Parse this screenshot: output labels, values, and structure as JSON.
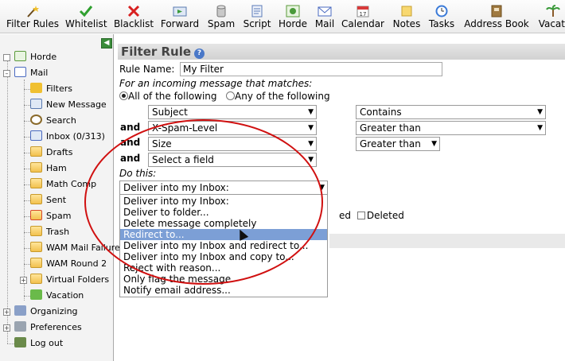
{
  "toolbar": {
    "items": [
      {
        "label": "Filter Rules",
        "icon": "wand-icon",
        "color": "#c89a2a"
      },
      {
        "label": "Whitelist",
        "icon": "checkmark-icon",
        "color": "#3a9a3a"
      },
      {
        "label": "Blacklist",
        "icon": "x-mark-icon",
        "color": "#d42020"
      },
      {
        "label": "Forward",
        "icon": "forward-icon",
        "color": "#3a8a4a"
      },
      {
        "label": "Spam",
        "icon": "spam-can-icon",
        "color": "#8a8a8a"
      },
      {
        "label": "Script",
        "icon": "script-icon",
        "color": "#5a7ab8"
      },
      {
        "label": "Horde",
        "icon": "horde-icon",
        "color": "#4a9a3a"
      },
      {
        "label": "Mail",
        "icon": "mail-icon",
        "color": "#4a6ac0"
      },
      {
        "label": "Calendar",
        "icon": "calendar-icon",
        "color": "#c83a3a"
      },
      {
        "label": "Notes",
        "icon": "notes-icon",
        "color": "#e8b84a"
      },
      {
        "label": "Tasks",
        "icon": "clock-icon",
        "color": "#3a7ad8"
      },
      {
        "label": "Address Book",
        "icon": "address-book-icon",
        "color": "#8a6a3a"
      },
      {
        "label": "Vacati",
        "icon": "palm-tree-icon",
        "color": "#3a9a3a"
      }
    ]
  },
  "sidebar": {
    "top_items": [
      {
        "label": "Horde",
        "icon": "horde-icon"
      },
      {
        "label": "Mail",
        "icon": "mail-icon"
      }
    ],
    "mail_items": [
      {
        "label": "Filters",
        "icon": "wand-icon"
      },
      {
        "label": "New Message",
        "icon": "compose-icon"
      },
      {
        "label": "Search",
        "icon": "search-icon"
      },
      {
        "label": "Inbox (0/313)",
        "icon": "inbox-icon"
      },
      {
        "label": "Drafts",
        "icon": "folder-icon"
      },
      {
        "label": "Ham",
        "icon": "folder-icon"
      },
      {
        "label": "Math Comp",
        "icon": "folder-icon"
      },
      {
        "label": "Sent",
        "icon": "sent-folder-icon"
      },
      {
        "label": "Spam",
        "icon": "spam-folder-icon"
      },
      {
        "label": "Trash",
        "icon": "folder-icon"
      },
      {
        "label": "WAM Mail Failure",
        "icon": "folder-icon"
      },
      {
        "label": "WAM Round 2",
        "icon": "folder-icon"
      },
      {
        "label": "Virtual Folders",
        "icon": "folder-icon"
      },
      {
        "label": "Vacation",
        "icon": "palm-tree-icon"
      }
    ],
    "bottom_items": [
      {
        "label": "Organizing",
        "icon": "organizing-icon"
      },
      {
        "label": "Preferences",
        "icon": "wrench-icon"
      },
      {
        "label": "Log out",
        "icon": "logout-icon"
      }
    ]
  },
  "main": {
    "title": "Filter Rule",
    "help_symbol": "?",
    "rule_name_label": "Rule Name:",
    "rule_name_value": "My Filter",
    "match_prompt": "For an incoming message that matches:",
    "match_all_label": "All of the following",
    "match_any_label": "Any of the following",
    "and_label": "and",
    "conditions": [
      {
        "field": "Subject",
        "operator": "Contains"
      },
      {
        "field": "X-Spam-Level",
        "operator": "Greater than"
      },
      {
        "field": "Size",
        "operator": "Greater than"
      },
      {
        "field": "Select a field",
        "operator": ""
      }
    ],
    "do_this_label": "Do this:",
    "action_selected": "Deliver into my Inbox:",
    "action_options": [
      "Deliver into my Inbox:",
      "Deliver to folder...",
      "Delete message completely",
      "Redirect to...",
      "Deliver into my Inbox and redirect to...",
      "Deliver into my Inbox and copy to...",
      "Reject with reason...",
      "Only flag the message",
      "Notify email address..."
    ],
    "highlighted_option_index": 3,
    "partial_flag_text": "ed",
    "deleted_label": "Deleted"
  },
  "colors": {
    "highlight": "#7c9fd6",
    "annotation": "#d01010",
    "header_bg": "#d8d8d8"
  }
}
